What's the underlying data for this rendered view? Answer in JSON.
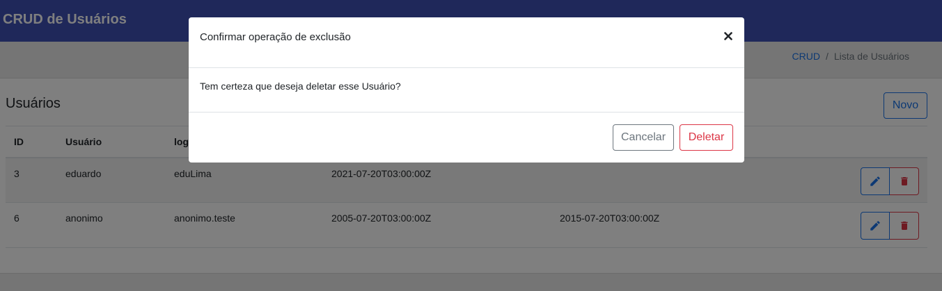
{
  "app": {
    "title": "CRUD de Usuários"
  },
  "breadcrumb": {
    "items": [
      "CRUD",
      "Lista de Usuários"
    ],
    "separator": "/"
  },
  "page": {
    "title": "Usuários",
    "new_button_label": "Novo"
  },
  "table": {
    "headers": [
      "ID",
      "Usuário",
      "login"
    ],
    "rows": [
      {
        "id": "3",
        "user": "eduardo",
        "login": "eduLima",
        "date1": "2021-07-20T03:00:00Z",
        "date2": ""
      },
      {
        "id": "6",
        "user": "anonimo",
        "login": "anonimo.teste",
        "date1": "2005-07-20T03:00:00Z",
        "date2": "2015-07-20T03:00:00Z"
      }
    ],
    "row_actions": [
      "pencil-icon",
      "trash-icon"
    ]
  },
  "modal": {
    "title": "Confirmar operação de exclusão",
    "close_label": "×",
    "body": "Tem certeza que deseja deletar esse Usuário?",
    "cancel_label": "Cancelar",
    "delete_label": "Deletar"
  },
  "colors": {
    "navbar": "#3f51b5",
    "primary": "#1a73e8",
    "danger": "#dc3545",
    "secondary": "#6c757d"
  }
}
